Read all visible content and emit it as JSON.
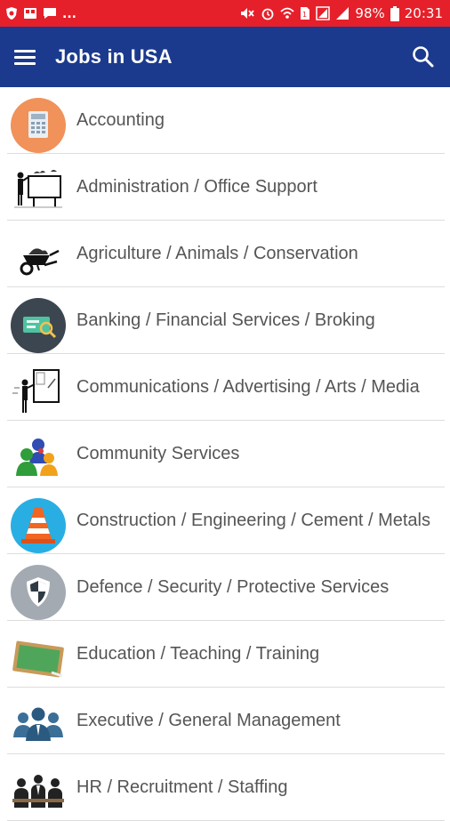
{
  "status_bar": {
    "notification_dots": "...",
    "battery_percent": "98%",
    "time": "20:31",
    "background": "#e5202a"
  },
  "app_bar": {
    "title": "Jobs in USA",
    "background": "#1b3a8e",
    "menu_icon": "hamburger-menu-icon",
    "search_icon": "search-icon"
  },
  "categories": [
    {
      "label": "Accounting",
      "icon": "calculator-icon"
    },
    {
      "label": "Administration / Office Support",
      "icon": "presentation-board-icon"
    },
    {
      "label": "Agriculture / Animals / Conservation",
      "icon": "wheelbarrow-icon"
    },
    {
      "label": "Banking / Financial Services / Broking",
      "icon": "banknote-icon"
    },
    {
      "label": "Communications / Advertising / Arts / Media",
      "icon": "sign-board-icon"
    },
    {
      "label": "Community Services",
      "icon": "people-group-icon"
    },
    {
      "label": "Construction / Engineering / Cement / Metals",
      "icon": "traffic-cone-icon"
    },
    {
      "label": "Defence / Security / Protective Services",
      "icon": "shield-icon"
    },
    {
      "label": "Education / Teaching / Training",
      "icon": "chalkboard-icon"
    },
    {
      "label": "Executive / General Management",
      "icon": "executives-icon"
    },
    {
      "label": "HR / Recruitment / Staffing",
      "icon": "recruitment-icon"
    }
  ]
}
